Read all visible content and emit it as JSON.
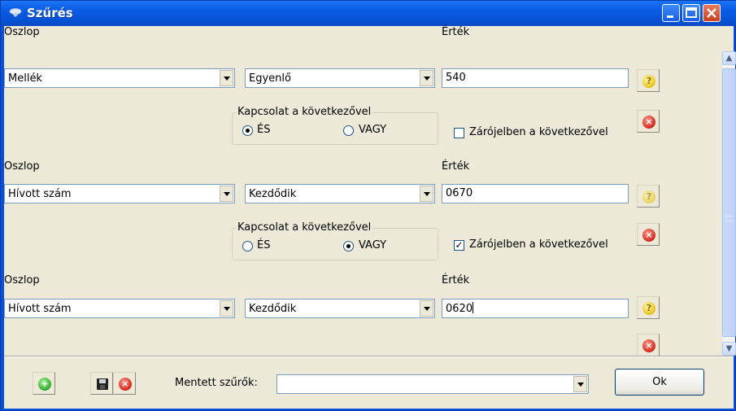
{
  "window": {
    "title": "Szűrés",
    "icon": "filter-icon",
    "controls": [
      "minimize",
      "maximize",
      "close"
    ]
  },
  "filters": [
    {
      "column_label": "Oszlop",
      "column_value": "Mellék",
      "operator_value": "Egyenlő",
      "value_label": "Érték",
      "value": "540",
      "group_label": "Kapcsolat a következővel",
      "and_label": "ÉS",
      "or_label": "VAGY",
      "connection": "ÉS",
      "bracket_label": "Zárójelben a következővel",
      "bracket_checked": false
    },
    {
      "column_label": "Oszlop",
      "column_value": "Hívott szám",
      "operator_value": "Kezdődik",
      "value_label": "Érték",
      "value": "0670",
      "group_label": "Kapcsolat a következővel",
      "and_label": "ÉS",
      "or_label": "VAGY",
      "connection": "VAGY",
      "bracket_label": "Zárójelben a következővel",
      "bracket_checked": true
    },
    {
      "column_label": "Oszlop",
      "column_value": "Hívott szám",
      "operator_value": "Kezdődik",
      "value_label": "Érték",
      "value": "0620"
    }
  ],
  "footer": {
    "saved_filters_label": "Mentett szűrők:",
    "saved_filters_value": "",
    "ok_label": "Ok"
  },
  "icons": {
    "help": "question-icon",
    "delete": "delete-icon",
    "add": "add-icon",
    "save": "save-icon"
  },
  "colors": {
    "titlebar": "#0b5de6",
    "client_bg": "#ece9d8",
    "help_icon": "#e8c21a",
    "delete_icon": "#d3261b",
    "add_icon": "#2ea82b"
  }
}
